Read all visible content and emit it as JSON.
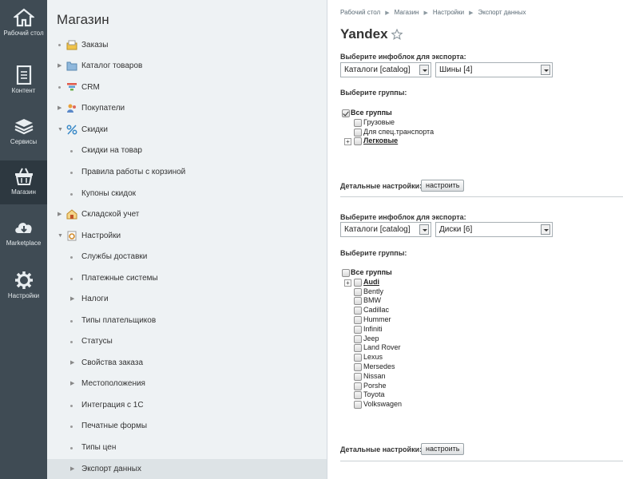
{
  "rail": [
    {
      "label": "Рабочий стол",
      "icon": "home-icon"
    },
    {
      "label": "Контент",
      "icon": "document-icon"
    },
    {
      "label": "Сервисы",
      "icon": "layers-icon"
    },
    {
      "label": "Магазин",
      "icon": "basket-icon",
      "active": true
    },
    {
      "label": "Marketplace",
      "icon": "cloud-download-icon"
    },
    {
      "label": "Настройки",
      "icon": "gear-icon"
    }
  ],
  "menu": {
    "title": "Магазин",
    "items": [
      {
        "label": "Заказы",
        "icon": "orders-icon"
      },
      {
        "label": "Каталог товаров",
        "icon": "folder-icon"
      },
      {
        "label": "CRM",
        "icon": "funnel-icon"
      },
      {
        "label": "Покупатели",
        "icon": "users-icon"
      },
      {
        "label": "Скидки",
        "icon": "percent-icon"
      },
      {
        "label": "Скидки на товар"
      },
      {
        "label": "Правила работы с корзиной"
      },
      {
        "label": "Купоны скидок"
      },
      {
        "label": "Складской учет",
        "icon": "warehouse-icon"
      },
      {
        "label": "Настройки",
        "icon": "settings-icon"
      },
      {
        "label": "Службы доставки"
      },
      {
        "label": "Платежные системы"
      },
      {
        "label": "Налоги"
      },
      {
        "label": "Типы плательщиков"
      },
      {
        "label": "Статусы"
      },
      {
        "label": "Свойства заказа"
      },
      {
        "label": "Местоположения"
      },
      {
        "label": "Интеграция с 1С"
      },
      {
        "label": "Печатные формы"
      },
      {
        "label": "Типы цен"
      },
      {
        "label": "Экспорт данных",
        "active": true
      }
    ]
  },
  "breadcrumbs": [
    "Рабочий стол",
    "Магазин",
    "Настройки",
    "Экспорт данных"
  ],
  "page_title": "Yandex",
  "block1": {
    "label_iblock": "Выберите инфоблок для экспорта:",
    "type_select": "Каталоги [catalog]",
    "iblock_select": "Шины [4]",
    "label_groups": "Выберите группы:",
    "all_groups": "Все группы",
    "groups": [
      "Грузовые",
      "Для спец.транспорта",
      "Легковые"
    ],
    "detail_label": "Детальные настройки:",
    "detail_button": "настроить"
  },
  "block2": {
    "label_iblock": "Выберите инфоблок для экспорта:",
    "type_select": "Каталоги [catalog]",
    "iblock_select": "Диски [6]",
    "label_groups": "Выберите группы:",
    "all_groups": "Все группы",
    "groups": [
      "Audi",
      "Bently",
      "BMW",
      "Cadillac",
      "Hummer",
      "Infiniti",
      "Jeep",
      "Land Rover",
      "Lexus",
      "Mersedes",
      "Nissan",
      "Porshe",
      "Toyota",
      "Volkswagen"
    ],
    "detail_label": "Детальные настройки:",
    "detail_button": "настроить"
  }
}
